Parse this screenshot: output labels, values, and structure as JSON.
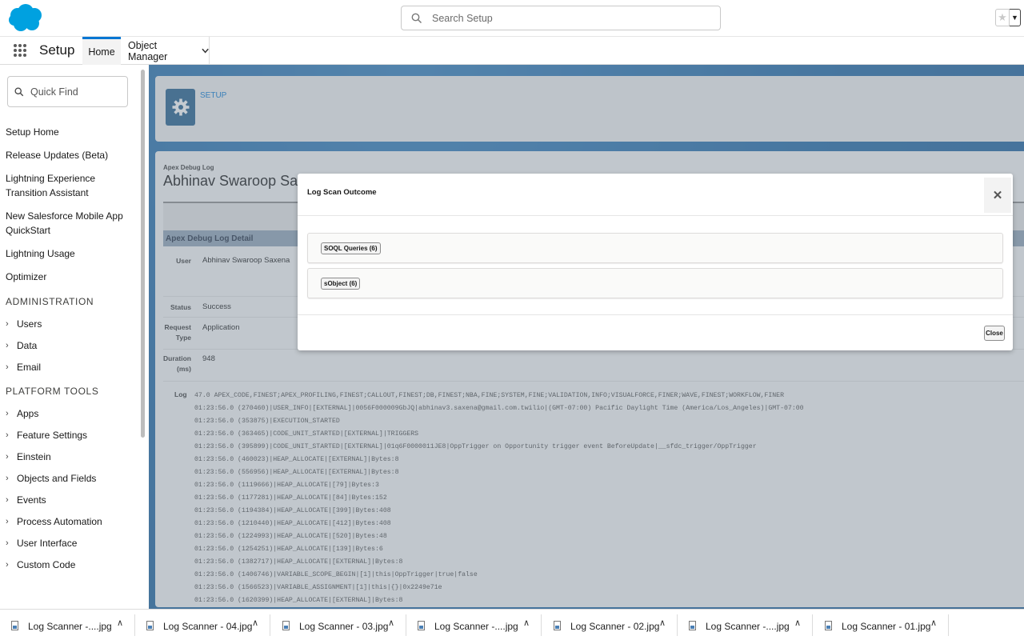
{
  "header": {
    "logo_icon": "salesforce-cloud-icon",
    "search_placeholder": "Search Setup",
    "favorites_icon": "star-icon"
  },
  "nav": {
    "app_name": "Setup",
    "tabs": [
      {
        "label": "Home",
        "active": true
      },
      {
        "label": "Object Manager",
        "has_dropdown": true
      }
    ]
  },
  "sidebar": {
    "quick_find_placeholder": "Quick Find",
    "links": [
      "Setup Home",
      "Release Updates (Beta)",
      "Lightning Experience Transition Assistant",
      "New Salesforce Mobile App QuickStart",
      "Lightning Usage",
      "Optimizer"
    ],
    "administration_heading": "ADMINISTRATION",
    "administration_items": [
      "Users",
      "Data",
      "Email"
    ],
    "platform_heading": "PLATFORM TOOLS",
    "platform_items": [
      "Apps",
      "Feature Settings",
      "Einstein",
      "Objects and Fields",
      "Events",
      "Process Automation",
      "User Interface",
      "Custom Code"
    ]
  },
  "main": {
    "setup_label": "SETUP",
    "breadcrumb": "Apex Debug Log",
    "record_title": "Abhinav Swaroop Saxena",
    "detail_heading": "Apex Debug Log Detail",
    "fields": {
      "user_label": "User",
      "user_value": "Abhinav Swaroop Saxena",
      "status_label": "Status",
      "status_value": "Success",
      "request_type_label": "Request Type",
      "request_type_value": "Application",
      "duration_label": "Duration (ms)",
      "duration_value": "948",
      "log_label": "Log"
    },
    "log_lines": [
      "47.0 APEX_CODE,FINEST;APEX_PROFILING,FINEST;CALLOUT,FINEST;DB,FINEST;NBA,FINE;SYSTEM,FINE;VALIDATION,INFO;VISUALFORCE,FINER;WAVE,FINEST;WORKFLOW,FINER",
      "01:23:56.0 (270460)|USER_INFO|[EXTERNAL]|0056F000009GbJQ|abhinav3.saxena@gmail.com.twilio|(GMT-07:00) Pacific Daylight Time (America/Los_Angeles)|GMT-07:00",
      "01:23:56.0 (353875)|EXECUTION_STARTED",
      "01:23:56.0 (363465)|CODE_UNIT_STARTED|[EXTERNAL]|TRIGGERS",
      "01:23:56.0 (395899)|CODE_UNIT_STARTED|[EXTERNAL]|01q6F0000011JE8|OppTrigger on Opportunity trigger event BeforeUpdate|__sfdc_trigger/OppTrigger",
      "01:23:56.0 (460023)|HEAP_ALLOCATE|[EXTERNAL]|Bytes:8",
      "01:23:56.0 (556956)|HEAP_ALLOCATE|[EXTERNAL]|Bytes:8",
      "01:23:56.0 (1119666)|HEAP_ALLOCATE|[79]|Bytes:3",
      "01:23:56.0 (1177281)|HEAP_ALLOCATE|[84]|Bytes:152",
      "01:23:56.0 (1194384)|HEAP_ALLOCATE|[399]|Bytes:408",
      "01:23:56.0 (1210440)|HEAP_ALLOCATE|[412]|Bytes:408",
      "01:23:56.0 (1224993)|HEAP_ALLOCATE|[520]|Bytes:48",
      "01:23:56.0 (1254251)|HEAP_ALLOCATE|[139]|Bytes:6",
      "01:23:56.0 (1382717)|HEAP_ALLOCATE|[EXTERNAL]|Bytes:8",
      "01:23:56.0 (1406746)|VARIABLE_SCOPE_BEGIN|[1]|this|OppTrigger|true|false",
      "01:23:56.0 (1566523)|VARIABLE_ASSIGNMENT|[1]|this|{}|0x2249e71e",
      "01:23:56.0 (1620399)|HEAP_ALLOCATE|[EXTERNAL]|Bytes:8"
    ]
  },
  "modal": {
    "title": "Log Scan Outcome",
    "sections": [
      "SOQL Queries (6)",
      "sObject (6)"
    ],
    "close_label": "Close"
  },
  "downloads": [
    "Log Scanner -....jpg",
    "Log Scanner - 04.jpg",
    "Log Scanner - 03.jpg",
    "Log Scanner -....jpg",
    "Log Scanner - 02.jpg",
    "Log Scanner -....jpg",
    "Log Scanner - 01.jpg"
  ],
  "colors": {
    "brand_blue": "#0176d3",
    "cloud_blue": "#00a1e0",
    "setup_gear_bg": "#1e5c8a",
    "detail_header": "#8fa2b6"
  }
}
